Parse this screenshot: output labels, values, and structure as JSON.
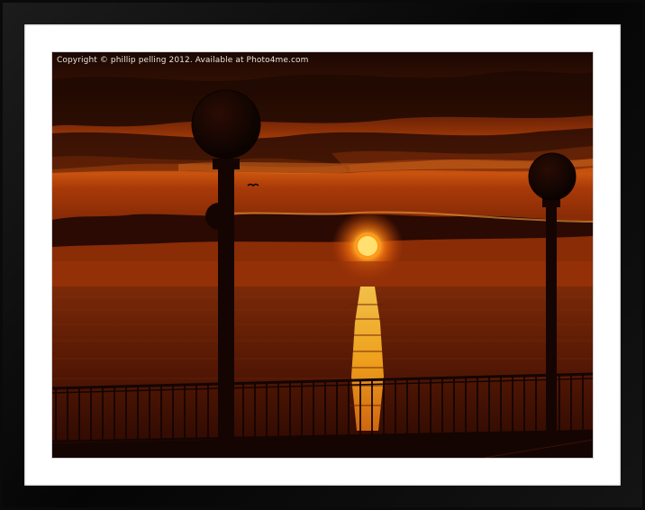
{
  "copyright_text": "Copyright © phillip pelling 2012. Available at Photo4me.com",
  "colors": {
    "frame": "#0a0a0a",
    "mat": "#ffffff",
    "sky_top": "#2a0c02",
    "sky_mid": "#8a2a06",
    "horizon": "#c24a0c",
    "sun": "#fff3a0",
    "sea": "#4a1204",
    "silhouette": "#140503"
  },
  "icons": [
    "street-lamp-icon",
    "seagull-icon",
    "sun-icon"
  ]
}
